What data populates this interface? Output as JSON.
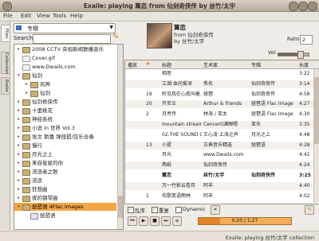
{
  "window": {
    "title": "Exaile: playing 篝恋 from 仙剑奇侠传 by 丝竹/太宇"
  },
  "menu": [
    "File",
    "Edit",
    "View",
    "Tools",
    "Help"
  ],
  "side_tabs": [
    "Files",
    "Collection",
    "Radio"
  ],
  "left": {
    "source": "专辑",
    "search_label": "Search:",
    "tree": [
      {
        "label": "2008 CCTV 央视新闻联播音乐",
        "type": "folder",
        "expand": "▸",
        "level": 0
      },
      {
        "label": "Cover.gif",
        "type": "file",
        "expand": "",
        "level": 0
      },
      {
        "label": "www.Dwails.com",
        "type": "file",
        "expand": "",
        "level": 0
      },
      {
        "label": "仙剑",
        "type": "folder",
        "expand": "▾",
        "level": 0
      },
      {
        "label": "风神",
        "type": "folder",
        "expand": "▸",
        "level": 1
      },
      {
        "label": "仙剑",
        "type": "folder",
        "expand": "▸",
        "level": 1
      },
      {
        "label": "仙剑奇侠传",
        "type": "folder",
        "expand": "▸",
        "level": 0
      },
      {
        "label": "十里桃花",
        "type": "folder",
        "expand": "▸",
        "level": 0
      },
      {
        "label": "神经系统",
        "type": "folder",
        "expand": "▸",
        "level": 0
      },
      {
        "label": "小说 in 世界 Vol.3",
        "type": "folder",
        "expand": "▸",
        "level": 0
      },
      {
        "label": "张文 斯嘉 弹琵琶/弦乐合奏",
        "type": "folder",
        "expand": "▸",
        "level": 0
      },
      {
        "label": "慢行",
        "type": "folder",
        "expand": "▸",
        "level": 0
      },
      {
        "label": "月光之上",
        "type": "folder",
        "expand": "▸",
        "level": 0
      },
      {
        "label": "来自星星的你",
        "type": "folder",
        "expand": "▸",
        "level": 0
      },
      {
        "label": "流浪者之歌",
        "type": "folder",
        "expand": "▸",
        "level": 0
      },
      {
        "label": "流浪",
        "type": "folder",
        "expand": "▸",
        "level": 0
      },
      {
        "label": "狂想曲",
        "type": "folder",
        "expand": "▸",
        "level": 0
      },
      {
        "label": "夜的钢琴曲",
        "type": "folder",
        "expand": "▸",
        "level": 0
      },
      {
        "label": "琵琶语 4Flac Images",
        "type": "folder",
        "expand": "▾",
        "level": 0,
        "selected": true
      },
      {
        "label": "琵琶语",
        "type": "music",
        "expand": "",
        "level": 1
      }
    ]
  },
  "now_playing": {
    "title": "篝恋",
    "from_line": "from 仙剑奇侠传",
    "by_line": "by 丝竹/太宇",
    "rating_label": "Rating:",
    "rating": "2",
    "vol_label": "Vol:",
    "volume": 0.7
  },
  "playlist": {
    "headers": [
      "#",
      "标题",
      "艺术家",
      "专辑",
      "长度"
    ],
    "tab_label": "播放",
    "rows": [
      {
        "num": "",
        "title": "相思",
        "artist": "",
        "album": "",
        "len": "3:22"
      },
      {
        "num": "",
        "title": "江湖·血问爱深",
        "artist": "佚名",
        "album": "仙剑奇侠传",
        "len": "3:14"
      },
      {
        "num": "19",
        "title": "听见我在心底叫着...",
        "artist": "琵琶",
        "album": "仙剑奇侠传",
        "len": "4:58"
      },
      {
        "num": "20",
        "title": "开尼兰",
        "artist": "Arthur & friends",
        "album": "琵琶语 Flac Image",
        "len": "4:27"
      },
      {
        "num": "2",
        "title": "月亮传",
        "artist": "林海 / 亚太",
        "album": "琵琶语 Flac Image",
        "len": "4:30"
      },
      {
        "num": "",
        "title": "mountain stream",
        "artist": "Cencerti满眼嗯",
        "album": "亚东",
        "len": "3:35"
      },
      {
        "num": "",
        "title": "02.THE SOUND OF MUSIC",
        "artist": "王心凌 上海之声",
        "album": "月光之上",
        "len": "4:48"
      },
      {
        "num": "13",
        "title": "小提",
        "artist": "古典音乐精选",
        "album": "琵琶语",
        "len": "4:28"
      },
      {
        "num": "",
        "title": "月光",
        "artist": "www.Dwails.com",
        "album": "",
        "len": "4:42"
      },
      {
        "num": "",
        "title": "两纸",
        "artist": "仙剑奇侠传",
        "album": "",
        "len": "4:24"
      },
      {
        "num": "",
        "title": "篝恋",
        "artist": "丝竹/太宇",
        "album": "仙剑奇侠传",
        "len": "3:25",
        "bold": true
      },
      {
        "num": "",
        "title": "万一竹影云卷月",
        "artist": "阿丰",
        "album": "",
        "len": "4:40"
      },
      {
        "num": "1",
        "title": "欢歌笑语雨林",
        "artist": "阿丰",
        "album": "",
        "len": "4:02"
      }
    ]
  },
  "controls": {
    "random": "乱序",
    "repeat": "重复",
    "dynamic": "Dynamic",
    "time": "0:20 / 1:27",
    "progress": 0.23
  },
  "status": "Exaile: playing 丝竹/太宇 collection"
}
